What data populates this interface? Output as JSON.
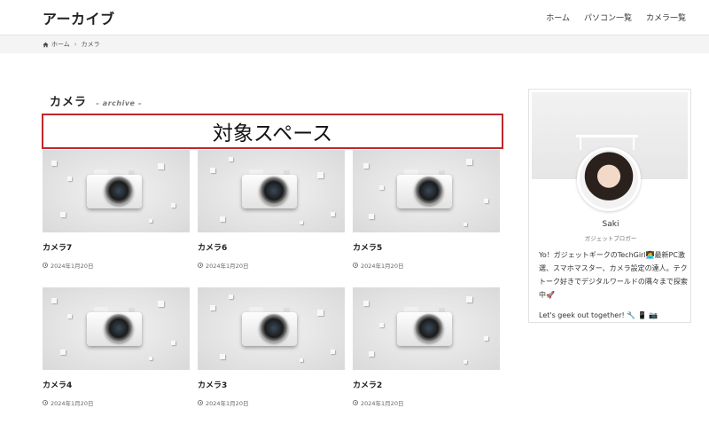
{
  "header": {
    "site_title": "アーカイブ",
    "nav": [
      "ホーム",
      "パソコン一覧",
      "カメラ一覧"
    ]
  },
  "breadcrumb": {
    "home": "ホーム",
    "current": "カメラ"
  },
  "archive": {
    "title": "カメラ",
    "subtitle": "– archive –"
  },
  "target_space": "対象スペース",
  "cards": [
    {
      "title": "カメラ7",
      "date": "2024年1月20日"
    },
    {
      "title": "カメラ6",
      "date": "2024年1月20日"
    },
    {
      "title": "カメラ5",
      "date": "2024年1月20日"
    },
    {
      "title": "カメラ4",
      "date": "2024年1月20日"
    },
    {
      "title": "カメラ3",
      "date": "2024年1月20日"
    },
    {
      "title": "カメラ2",
      "date": "2024年1月20日"
    }
  ],
  "profile": {
    "name": "Saki",
    "role": "ガジェットブロガー",
    "bio": "Yo！ガジェットギークのTechGirl👩‍💻最新PC激選、スマホマスター、カメラ設定の達人。テクトーク好きでデジタルワールドの隅々まで探索中🚀",
    "footer": "Let's geek out together! 🔧 📱 📷"
  },
  "colors": {
    "target_border": "#c0262c",
    "breadcrumb_bg": "#f4f4f4"
  }
}
